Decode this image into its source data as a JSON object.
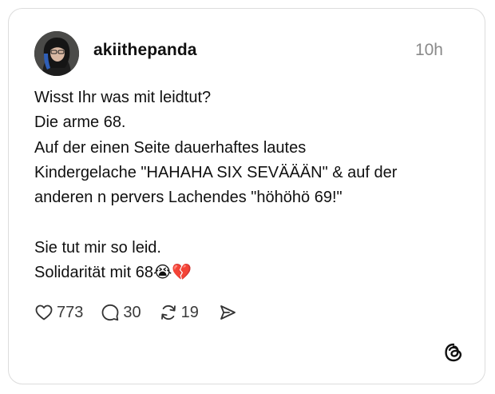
{
  "post": {
    "username": "akiithepanda",
    "timestamp": "10h",
    "lines": [
      "Wisst Ihr was mit leidtut?",
      "Die arme 68.",
      "Auf der einen Seite dauerhaftes lautes",
      "Kindergelache \"HAHAHA SIX SEVÄÄÄN\" & auf der",
      "anderen n pervers Lachendes \"höhöhö 69!\"",
      "",
      "Sie tut mir so leid.",
      "Solidarität mit 68😭💔"
    ]
  },
  "actions": {
    "likes": "773",
    "replies": "30",
    "reposts": "19"
  },
  "icons": {
    "like": "heart-icon",
    "reply": "speech-bubble-icon",
    "repost": "repost-arrows-icon",
    "share": "paper-plane-icon",
    "brand": "threads-logo-icon"
  },
  "colors": {
    "text": "#101010",
    "muted": "#8a8a8a",
    "border": "#dcdcdc"
  }
}
